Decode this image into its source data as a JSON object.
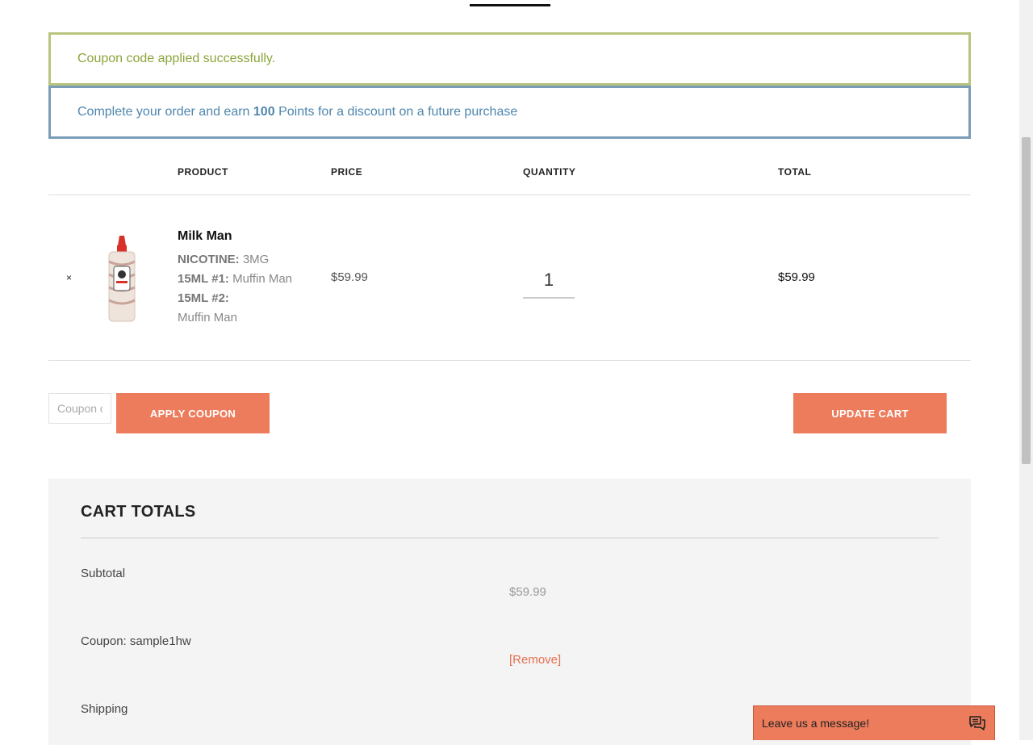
{
  "notices": {
    "success": "Coupon code applied successfully.",
    "points_prefix": "Complete your order and earn",
    "points_value": "100",
    "points_suffix": "Points for a discount on a future purchase"
  },
  "cart": {
    "headers": {
      "product": "PRODUCT",
      "price": "PRICE",
      "quantity": "QUANTITY",
      "total": "TOTAL"
    },
    "item": {
      "remove": "×",
      "name": "Milk Man",
      "meta": [
        {
          "key": "NICOTINE:",
          "value": "3MG"
        },
        {
          "key": "15ML #1:",
          "value": "Muffin Man"
        },
        {
          "key": "15ML #2:",
          "value": "Muffin Man"
        }
      ],
      "price": "$59.99",
      "quantity": "1",
      "total": "$59.99"
    }
  },
  "actions": {
    "coupon_placeholder": "Coupon code",
    "apply_label": "APPLY COUPON",
    "update_label": "UPDATE CART"
  },
  "totals": {
    "title": "CART TOTALS",
    "subtotal_label": "Subtotal",
    "subtotal_value": "$59.99",
    "coupon_label": "Coupon: sample1hw",
    "coupon_remove": "[Remove]",
    "shipping_label": "Shipping"
  },
  "chat": {
    "label": "Leave us a message!",
    "icon": "chat-bubble-icon"
  },
  "colors": {
    "accent": "#ec7c5c",
    "success": "#8aa53a",
    "info": "#4f86ad"
  }
}
